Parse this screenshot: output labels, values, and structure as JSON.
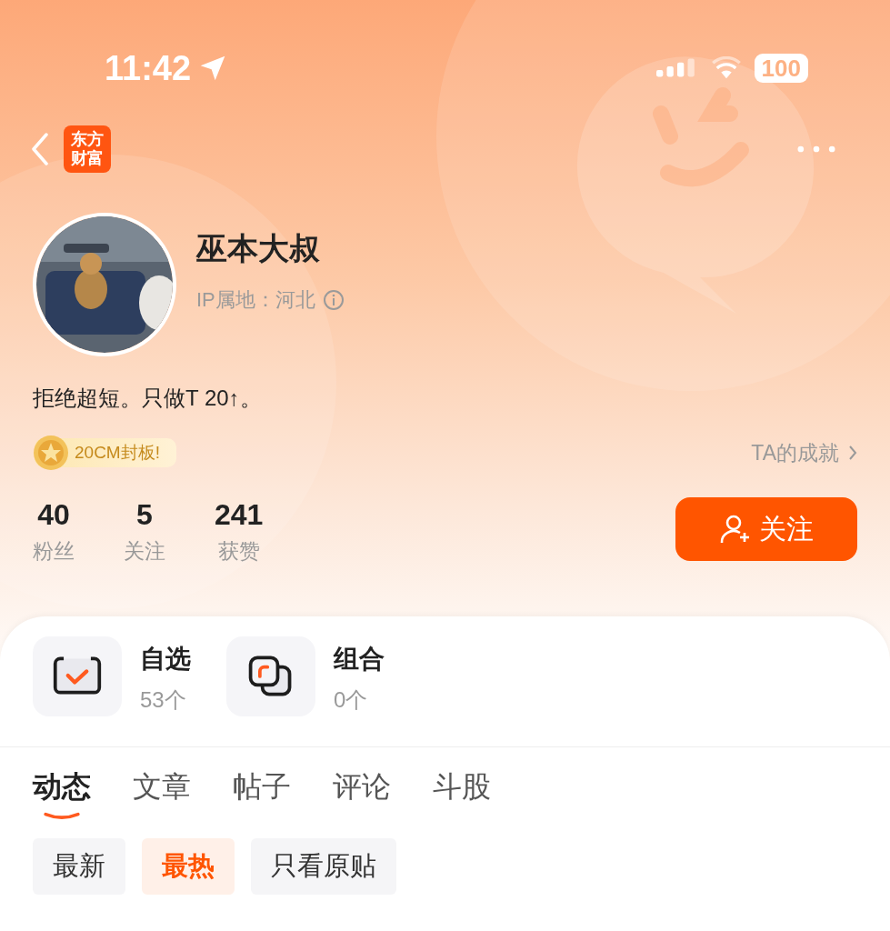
{
  "status_bar": {
    "time": "11:42",
    "battery": "100"
  },
  "nav": {
    "logo_lines": [
      "东方",
      "财富"
    ]
  },
  "profile": {
    "name": "巫本大叔",
    "ip_location": "IP属地：河北",
    "bio": "拒绝超短。只做T 20↑。",
    "badge": "20CM封板!",
    "achievements_link": "TA的成就"
  },
  "stats": [
    {
      "value": "40",
      "label": "粉丝"
    },
    {
      "value": "5",
      "label": "关注"
    },
    {
      "value": "241",
      "label": "获赞"
    }
  ],
  "follow_button": "关注",
  "shortcuts": [
    {
      "kind": "watchlist",
      "title": "自选",
      "count": "53个"
    },
    {
      "kind": "portfolio",
      "title": "组合",
      "count": "0个"
    }
  ],
  "tabs": [
    {
      "label": "动态",
      "selected": true
    },
    {
      "label": "文章",
      "selected": false
    },
    {
      "label": "帖子",
      "selected": false
    },
    {
      "label": "评论",
      "selected": false
    },
    {
      "label": "斗股",
      "selected": false
    }
  ],
  "filters": [
    {
      "label": "最新",
      "selected": false
    },
    {
      "label": "最热",
      "selected": true
    },
    {
      "label": "只看原贴",
      "selected": false
    }
  ]
}
